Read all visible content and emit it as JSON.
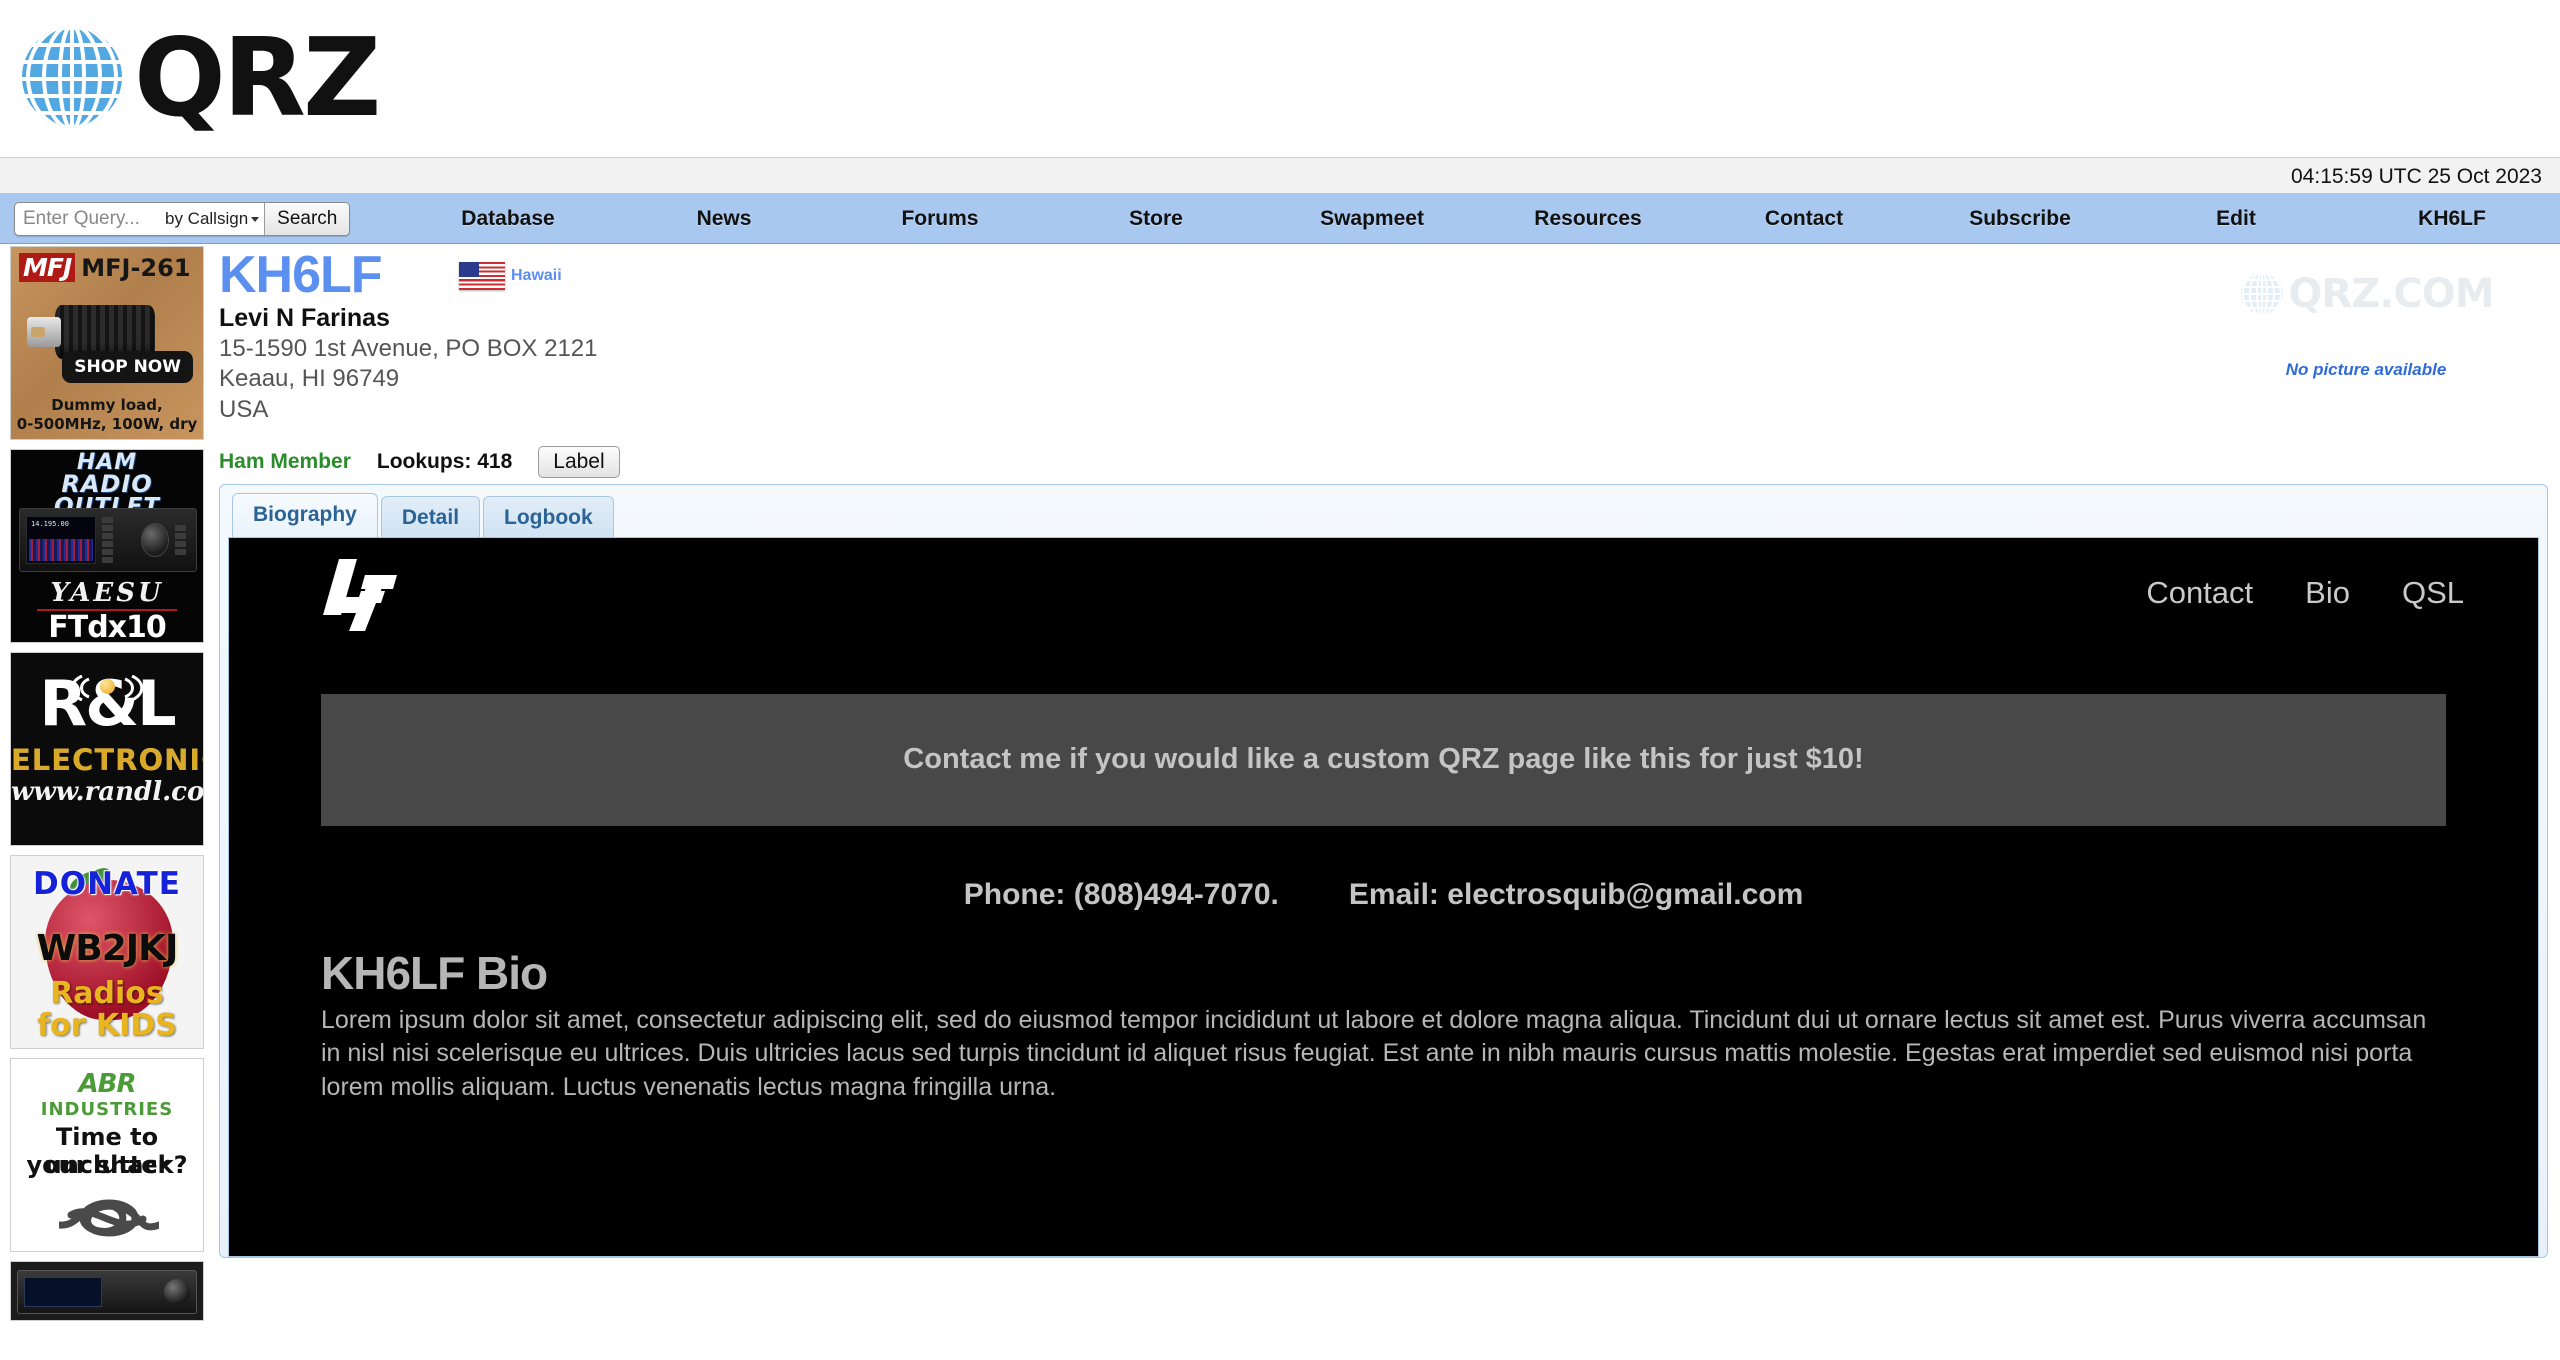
{
  "site": {
    "logo_text": "QRZ",
    "logo_icon": "globe-grid-icon"
  },
  "header": {
    "utc_time": "04:15:59 UTC 25 Oct 2023"
  },
  "search": {
    "placeholder": "Enter Query...",
    "value": "",
    "mode_label": "by Callsign",
    "button_label": "Search"
  },
  "nav": {
    "items": [
      {
        "label": "Database"
      },
      {
        "label": "News"
      },
      {
        "label": "Forums"
      },
      {
        "label": "Store"
      },
      {
        "label": "Swapmeet"
      },
      {
        "label": "Resources"
      },
      {
        "label": "Contact"
      },
      {
        "label": "Subscribe"
      },
      {
        "label": "Edit"
      },
      {
        "label": "KH6LF"
      }
    ]
  },
  "sidebar": {
    "ads": [
      {
        "name": "mfj-261",
        "brand": "MFJ",
        "model": "MFJ-261",
        "cta": "SHOP NOW",
        "caption_line1": "Dummy load,",
        "caption_line2": "0-500MHz, 100W, dry"
      },
      {
        "name": "ham-radio-outlet",
        "line1": "HAM",
        "line2": "RADIO",
        "line3": "OUTLET",
        "brand": "YAESU",
        "model": "FTdx10",
        "rig_freq": "14.195.00"
      },
      {
        "name": "rl-electronics",
        "title": "R&L",
        "subtitle": "ELECTRONICS",
        "url": "www.randl.com"
      },
      {
        "name": "wb2jkj-radios-for-kids",
        "donate": "DONATE",
        "callsign": "WB2JKJ",
        "line1": "Radios",
        "line2": "for KIDS"
      },
      {
        "name": "abr-industries",
        "brand": "ABR",
        "sub": "INDUSTRIES",
        "line1": "Time to unclutter",
        "line2": "your shack?"
      },
      {
        "name": "transceiver-ad"
      }
    ]
  },
  "callsign_record": {
    "callsign": "KH6LF",
    "flag_label": "Hawaii",
    "flag_icon": "us-flag-icon",
    "name": "Levi N Farinas",
    "address_line1": "15-1590 1st Avenue, PO BOX 2121",
    "address_line2": "Keaau, HI 96749",
    "address_line3": "USA",
    "member_status": "Ham Member",
    "lookups": "Lookups: 418",
    "label_button": "Label",
    "picture_placeholder": "No picture available",
    "watermark_text": "QRZ.COM"
  },
  "tabs": [
    {
      "label": "Biography",
      "active": true
    },
    {
      "label": "Detail",
      "active": false
    },
    {
      "label": "Logbook",
      "active": false
    }
  ],
  "biography": {
    "logo_text": "LF",
    "nav": [
      {
        "label": "Contact"
      },
      {
        "label": "Bio"
      },
      {
        "label": "QSL"
      }
    ],
    "promo": "Contact me if you would like a custom QRZ page like this for just $10!",
    "phone": "Phone: (808)494-7070.",
    "email": "Email: electrosquib@gmail.com",
    "title": "KH6LF Bio",
    "body": "Lorem ipsum dolor sit amet, consectetur adipiscing elit, sed do eiusmod tempor incididunt ut labore et dolore magna aliqua. Tincidunt dui ut ornare lectus sit amet est. Purus viverra accumsan in nisl nisi scelerisque eu ultrices. Duis ultricies lacus sed turpis tincidunt id aliquet risus feugiat. Est ante in nibh mauris cursus mattis molestie. Egestas erat imperdiet sed euismod nisi porta lorem mollis aliquam. Luctus venenatis lectus magna fringilla urna."
  },
  "colors": {
    "nav_bg": "#a8c8f0",
    "callsign": "#5b8ff0",
    "member": "#2a8c2a",
    "promo_bg": "#484848",
    "bio_bg": "#000000"
  }
}
